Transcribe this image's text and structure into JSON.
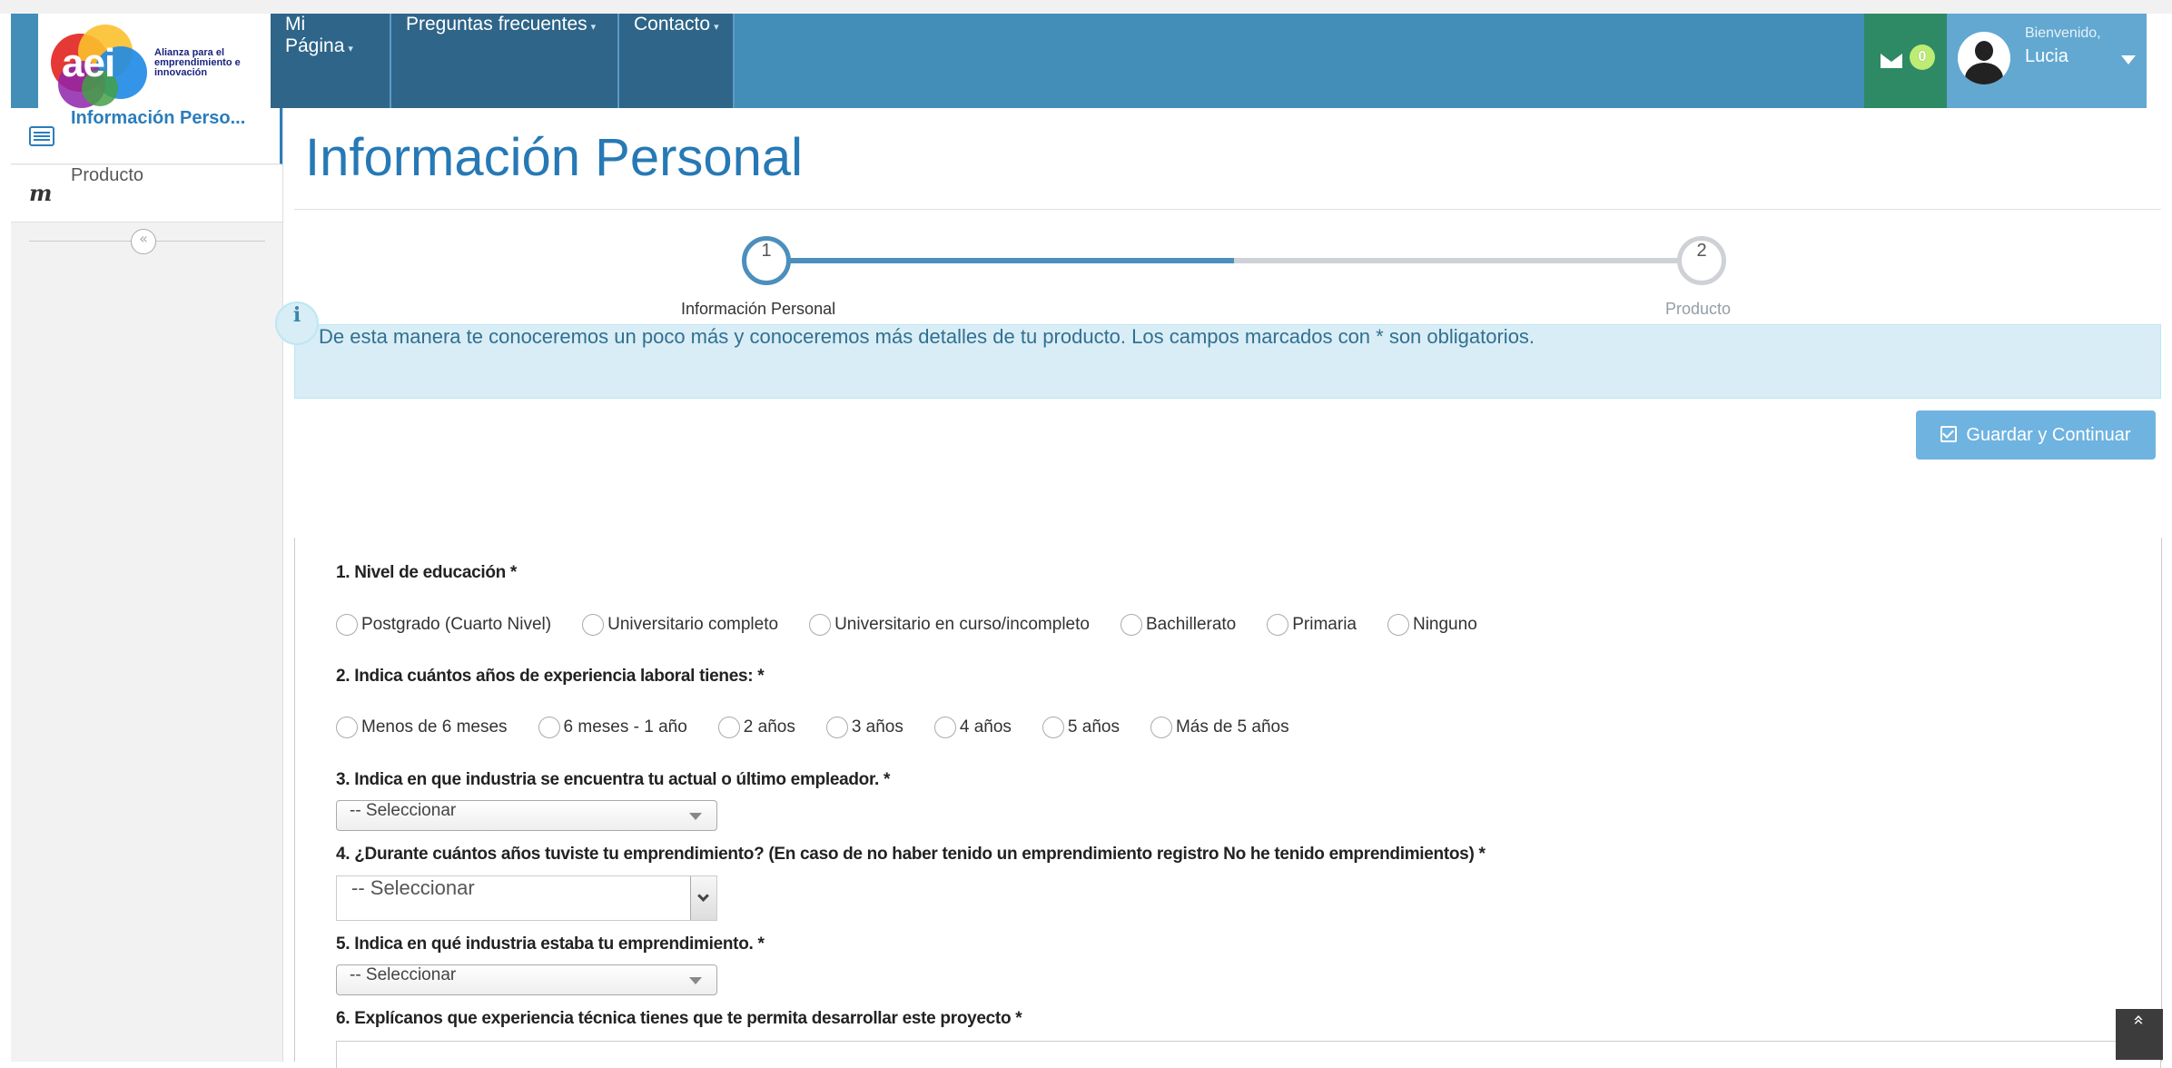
{
  "app": {
    "logo_text": "aei",
    "logo_tagline": "Alianza para el emprendimiento e innovación"
  },
  "nav": {
    "items": [
      {
        "label": "Mi Página"
      },
      {
        "label": "Preguntas frecuentes"
      },
      {
        "label": "Contacto"
      }
    ],
    "messages_count": "0",
    "welcome": "Bienvenido,",
    "user_name": "Lucia"
  },
  "sidebar": {
    "items": [
      {
        "label": "Información Perso...",
        "icon": "list-icon",
        "active": true
      },
      {
        "label": "Producto",
        "icon": "m-icon",
        "active": false
      }
    ],
    "collapse_glyph": "«"
  },
  "page": {
    "title": "Información Personal"
  },
  "wizard": {
    "steps": [
      {
        "number": "1",
        "label": "Información Personal",
        "state": "active"
      },
      {
        "number": "2",
        "label": "Producto",
        "state": "pending"
      }
    ],
    "progress": 0.5,
    "active_color": "#4c8fbd",
    "inactive_color": "#ced1d6"
  },
  "info": {
    "icon_glyph": "i",
    "text": "De esta manera te conoceremos un poco más y conoceremos más detalles de tu producto. Los campos marcados con * son obligatorios."
  },
  "actions": {
    "save_label": "Guardar y Continuar"
  },
  "form": {
    "q1": {
      "label": "1. Nivel de educación *",
      "options": [
        "Postgrado (Cuarto Nivel)",
        "Universitario completo",
        "Universitario en curso/incompleto",
        "Bachillerato",
        "Primaria",
        "Ninguno"
      ]
    },
    "q2": {
      "label": "2. Indica cuántos años de experiencia laboral tienes: *",
      "options": [
        "Menos de 6 meses",
        "6 meses - 1 año",
        "2 años",
        "3 años",
        "4 años",
        "5 años",
        "Más de 5 años"
      ]
    },
    "q3": {
      "label": "3. Indica en que industria se encuentra tu actual o último empleador. *",
      "value": "-- Seleccionar"
    },
    "q4": {
      "label": "4. ¿Durante cuántos años tuviste tu emprendimiento? (En caso de no haber tenido un emprendimiento registro No he tenido emprendimientos) *",
      "value": "-- Seleccionar"
    },
    "q5": {
      "label": "5. Indica en qué industria estaba tu emprendimiento. *",
      "value": "-- Seleccionar"
    },
    "q6": {
      "label": "6. Explícanos que experiencia técnica tienes que te permita desarrollar este proyecto *"
    }
  },
  "scroll_top_glyph": "«"
}
